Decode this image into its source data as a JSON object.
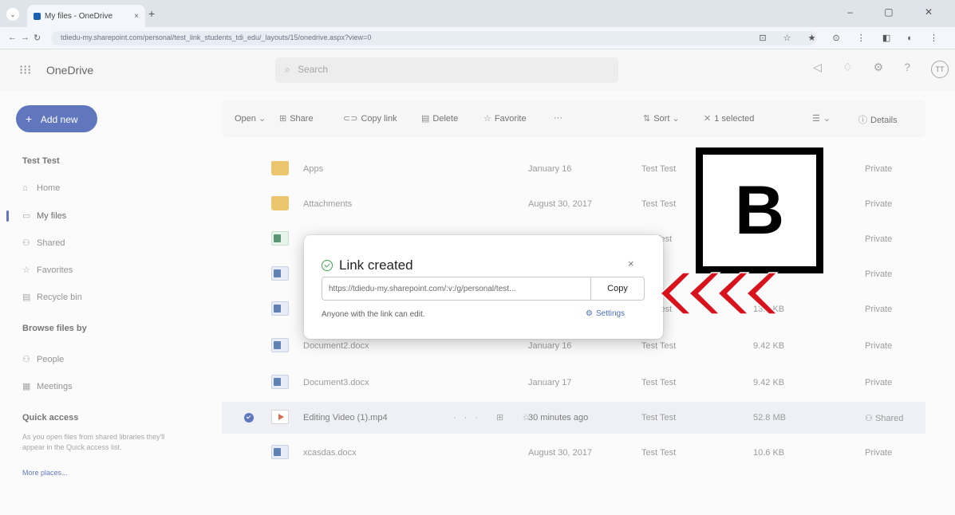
{
  "browser": {
    "tab_title": "My files - OneDrive",
    "tab_close": "×",
    "tab_chevron": "⌄",
    "new_tab": "+",
    "url": "tdiedu-my.sharepoint.com/personal/test_link_students_tdi_edu/_layouts/15/onedrive.aspx?view=0",
    "window_controls": "– ▢ ✕",
    "extension_icons": "⊡ ☆ ★ ⊙ ⋮ ◧ ◐ ⋮"
  },
  "app": {
    "name": "OneDrive",
    "search_placeholder": "Search",
    "avatar_initials": "TT"
  },
  "sidebar": {
    "add_new": "Add new",
    "user_heading": "Test Test",
    "items": [
      {
        "label": "Home",
        "icon": "⌂"
      },
      {
        "label": "My files",
        "icon": "▭"
      },
      {
        "label": "Shared",
        "icon": "⚇"
      },
      {
        "label": "Favorites",
        "icon": "☆"
      },
      {
        "label": "Recycle bin",
        "icon": "▤"
      }
    ],
    "browse_heading": "Browse files by",
    "browse_items": [
      {
        "label": "People",
        "icon": "⚇"
      },
      {
        "label": "Meetings",
        "icon": "▦"
      }
    ],
    "quick_heading": "Quick access",
    "quick_desc": "As you open files from shared libraries they'll appear in the Quick access list.",
    "more_places": "More places..."
  },
  "commandbar": {
    "open": "Open",
    "share": "Share",
    "copy_link": "Copy link",
    "delete": "Delete",
    "favorite": "Favorite",
    "more": "···",
    "sort": "Sort",
    "selected": "1 selected",
    "details": "Details"
  },
  "files": [
    {
      "name": "Apps",
      "type": "folder",
      "modified": "January 16",
      "modified_by": "Test Test",
      "size": "",
      "sharing": "Private"
    },
    {
      "name": "Attachments",
      "type": "folder",
      "modified": "August 30, 2017",
      "modified_by": "Test Test",
      "size": "",
      "sharing": "Private"
    },
    {
      "name": "",
      "type": "excel",
      "modified": "",
      "modified_by": "Test",
      "size": "",
      "sharing": "Private"
    },
    {
      "name": "",
      "type": "word",
      "modified": "",
      "modified_by": "",
      "size": "",
      "sharing": "Private"
    },
    {
      "name": "",
      "type": "word",
      "modified": "",
      "modified_by": "Test",
      "size": "13.9 KB",
      "sharing": "Private"
    },
    {
      "name": "Document2.docx",
      "type": "word",
      "modified": "January 16",
      "modified_by": "Test Test",
      "size": "9.42 KB",
      "sharing": "Private"
    },
    {
      "name": "Document3.docx",
      "type": "word",
      "modified": "January 17",
      "modified_by": "Test Test",
      "size": "9.42 KB",
      "sharing": "Private"
    },
    {
      "name": "Editing Video (1).mp4",
      "type": "video",
      "modified": "30 minutes ago",
      "modified_by": "Test Test",
      "size": "52.8 MB",
      "sharing": "Shared"
    },
    {
      "name": "xcasdas.docx",
      "type": "word",
      "modified": "August 30, 2017",
      "modified_by": "Test Test",
      "size": "10.6 KB",
      "sharing": "Private"
    }
  ],
  "dialog": {
    "title": "Link created",
    "close": "×",
    "link": "https://tdiedu-my.sharepoint.com/:v:/g/personal/test...",
    "copy_label": "Copy",
    "note": "Anyone with the link can edit.",
    "settings": "Settings"
  },
  "annotation": {
    "label": "B",
    "arrow_color": "#d7141d"
  }
}
